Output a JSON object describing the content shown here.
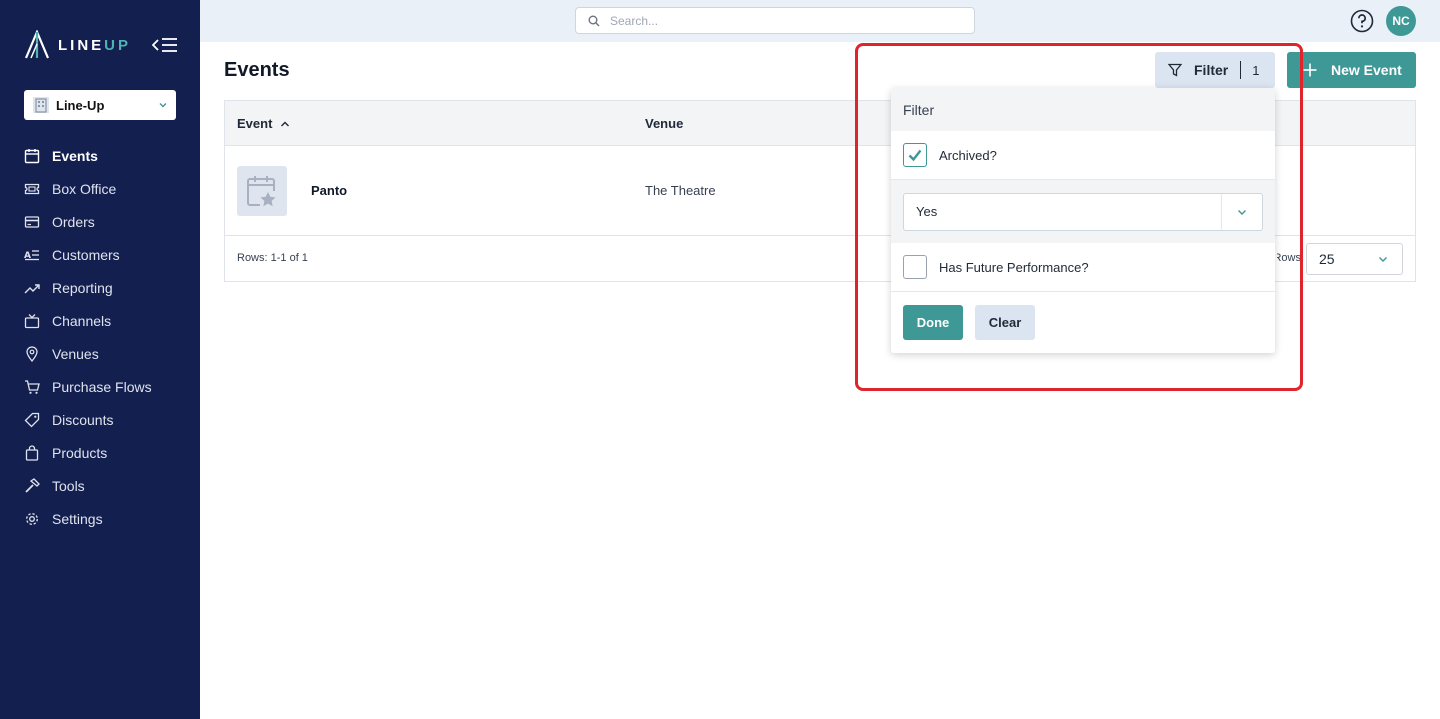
{
  "app": {
    "logo_text_a": "LINE",
    "logo_text_b": "UP",
    "org_name": "Line-Up"
  },
  "sidebar": {
    "items": [
      {
        "label": "Events",
        "icon": "calendar-icon",
        "active": true
      },
      {
        "label": "Box Office",
        "icon": "ticket-icon",
        "active": false
      },
      {
        "label": "Orders",
        "icon": "credit-card-icon",
        "active": false
      },
      {
        "label": "Customers",
        "icon": "customer-list-icon",
        "active": false
      },
      {
        "label": "Reporting",
        "icon": "trend-chart-icon",
        "active": false
      },
      {
        "label": "Channels",
        "icon": "tv-icon",
        "active": false
      },
      {
        "label": "Venues",
        "icon": "map-pin-icon",
        "active": false
      },
      {
        "label": "Purchase Flows",
        "icon": "cart-icon",
        "active": false
      },
      {
        "label": "Discounts",
        "icon": "tag-icon",
        "active": false
      },
      {
        "label": "Products",
        "icon": "shopping-bag-icon",
        "active": false
      },
      {
        "label": "Tools",
        "icon": "hammer-icon",
        "active": false
      },
      {
        "label": "Settings",
        "icon": "gear-icon",
        "active": false
      }
    ]
  },
  "topbar": {
    "search_placeholder": "Search...",
    "avatar_initials": "NC"
  },
  "main": {
    "title": "Events",
    "filter_label": "Filter",
    "filter_count": "1",
    "new_event_label": "New Event",
    "table": {
      "columns": [
        "Event",
        "Venue"
      ],
      "rows": [
        {
          "event": "Panto",
          "venue": "The Theatre"
        }
      ],
      "rows_info": "Rows: 1-1 of 1",
      "rows_per_page_label": "Rows:",
      "rows_per_page_value": "25"
    }
  },
  "filter_panel": {
    "title": "Filter",
    "archived_label": "Archived?",
    "archived_checked": true,
    "archived_value": "Yes",
    "future_label": "Has Future Performance?",
    "future_checked": false,
    "done_label": "Done",
    "clear_label": "Clear"
  },
  "colors": {
    "sidebar_bg": "#131f4f",
    "accent": "#3d9896",
    "highlight": "#e0242b"
  }
}
